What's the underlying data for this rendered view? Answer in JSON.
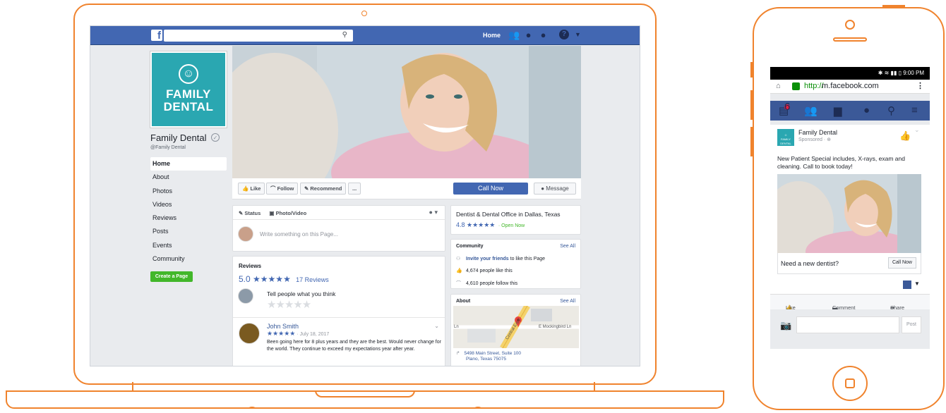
{
  "colors": {
    "accent": "#f0832d",
    "facebook_blue": "#4267b2",
    "brand_teal": "#2aa7b1"
  },
  "laptop": {
    "topbar": {
      "home_label": "Home",
      "search_icon": "search-icon"
    },
    "page": {
      "brand_line1": "FAMILY",
      "brand_line2": "DENTAL",
      "name": "Family Dental",
      "handle": "@Family Dental",
      "nav": [
        "Home",
        "About",
        "Photos",
        "Videos",
        "Reviews",
        "Posts",
        "Events",
        "Community"
      ],
      "create_page": "Create a Page"
    },
    "actions": {
      "like": "Like",
      "follow": "Follow",
      "recommend": "Recommend",
      "more": "...",
      "call_now": "Call Now",
      "message": "Message"
    },
    "composer": {
      "status": "Status",
      "photo_video": "Photo/Video",
      "placeholder": "Write something on this Page..."
    },
    "reviews": {
      "title": "Reviews",
      "score": "5.0",
      "stars": "★★★★★",
      "count": "17 Reviews",
      "prompt": "Tell people what you think",
      "empty_stars": "★★★★★",
      "item": {
        "name": "John Smith",
        "stars": "★★★★★",
        "date": "· July 18, 2017",
        "text": "Been going here for 8 plus years and they are the best. Would never change for the world. They continue to exceed my expectations year after year."
      }
    },
    "info": {
      "title": "Dentist & Dental Office in Dallas, Texas",
      "rating": "4.8",
      "stars": "★★★★★",
      "open": "· Open Now"
    },
    "community": {
      "title": "Community",
      "see_all": "See All",
      "invite_link": "Invite your friends",
      "invite_rest": " to like this Page",
      "likes": "4,674 people like this",
      "follows": "4,610 people follow this"
    },
    "about": {
      "title": "About",
      "see_all": "See All",
      "map_ln": "Ln",
      "map_road": "Central Expy",
      "map_street": "E Mockingbird Ln",
      "addr1": "5498 Main Street, Suite 100",
      "addr2": "Plano, Texas 75075"
    }
  },
  "phone": {
    "status_time": "9:00 PM",
    "url_scheme": "http://",
    "url_domain": "m.facebook.com",
    "badge": "6",
    "post": {
      "name": "Family Dental",
      "sponsored": "Sponsored · ⊕",
      "text": "New Patient Special includes, X-rays, exam and cleaning. Call to book today!",
      "cta_text": "Need a new dentist?",
      "cta_button": "Call Now"
    },
    "actions": {
      "like": "Like",
      "comment": "Comment",
      "share": "Share"
    },
    "post_button": "Post"
  }
}
